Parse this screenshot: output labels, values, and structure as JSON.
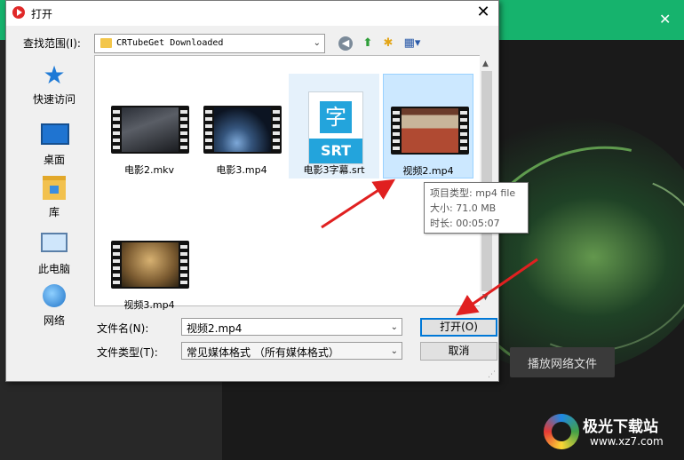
{
  "background_app": {
    "play_network_button": "播放网络文件",
    "watermark_title": "极光下载站",
    "watermark_url": "www.xz7.com"
  },
  "dialog": {
    "title": "打开",
    "close_glyph": "✕",
    "look_in_label": "查找范围(I):",
    "look_in_value": "CRTubeGet Downloaded",
    "places": [
      {
        "label": "快速访问",
        "icon": "quick-access-icon"
      },
      {
        "label": "桌面",
        "icon": "desktop-icon"
      },
      {
        "label": "库",
        "icon": "library-icon"
      },
      {
        "label": "此电脑",
        "icon": "computer-icon"
      },
      {
        "label": "网络",
        "icon": "network-icon"
      }
    ],
    "files": [
      {
        "name": "电影2.mkv",
        "type": "video"
      },
      {
        "name": "电影3.mp4",
        "type": "video"
      },
      {
        "name": "电影3字幕.srt",
        "type": "subtitle",
        "icon_char": "字",
        "icon_text": "SRT"
      },
      {
        "name": "视频2.mp4",
        "type": "video",
        "selected": true
      },
      {
        "name": "视频3.mp4",
        "type": "video"
      }
    ],
    "tooltip": {
      "type_line": "项目类型: mp4 file",
      "size_line": "大小: 71.0 MB",
      "duration_line": "时长: 00:05:07"
    },
    "file_name_label": "文件名(N):",
    "file_name_value": "视频2.mp4",
    "file_type_label": "文件类型(T):",
    "file_type_value": "常见媒体格式 （所有媒体格式）",
    "open_button": "打开(O)",
    "cancel_button": "取消"
  },
  "colors": {
    "app_accent": "#16b36d",
    "selection": "#cce8ff",
    "annotation_arrow": "#e02020"
  }
}
